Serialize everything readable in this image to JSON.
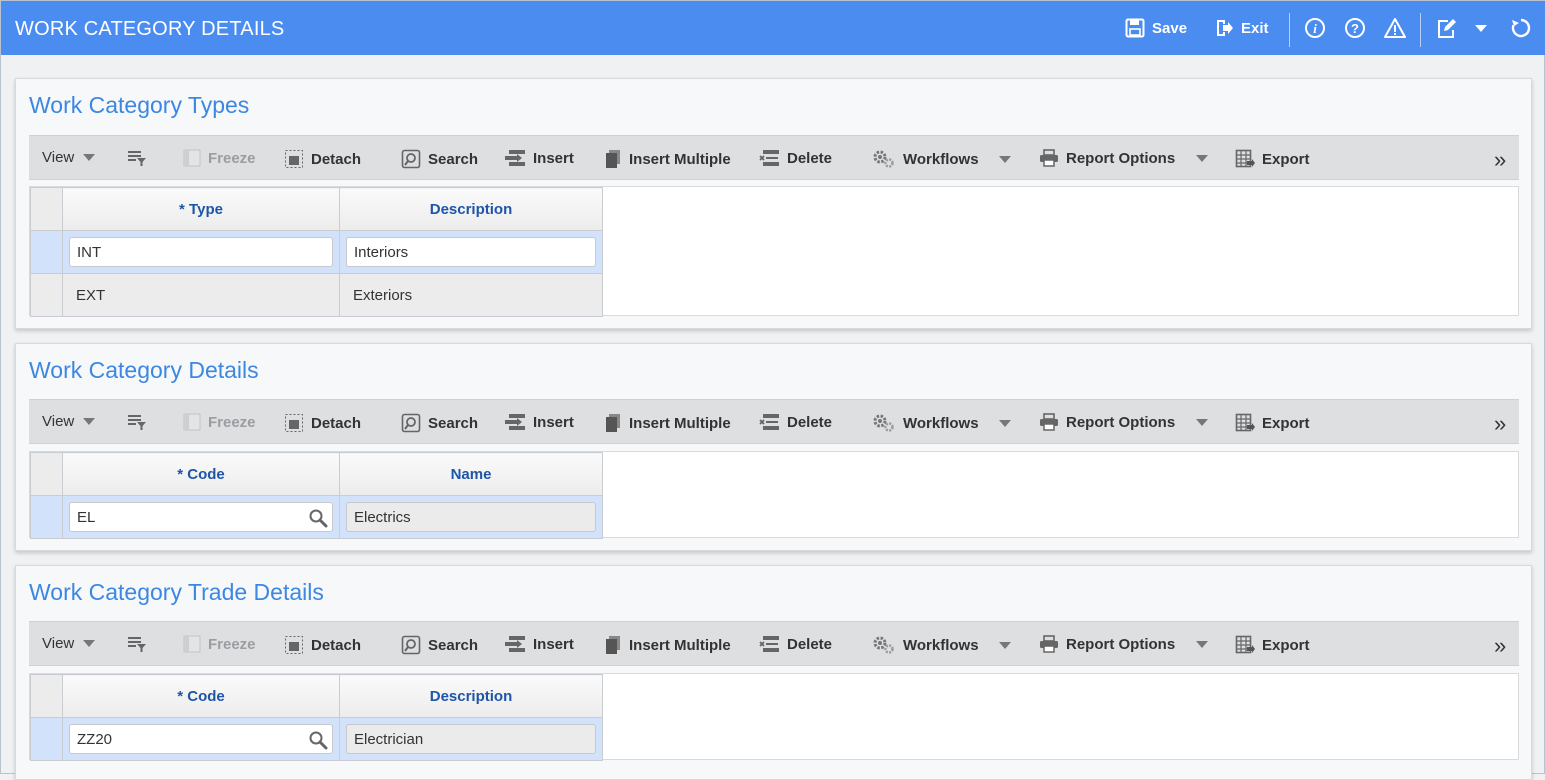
{
  "header": {
    "title": "WORK CATEGORY DETAILS",
    "save_label": "Save",
    "exit_label": "Exit",
    "accent": "#4a8cf0"
  },
  "toolbar": {
    "view": "View",
    "freeze": "Freeze",
    "detach": "Detach",
    "search": "Search",
    "insert": "Insert",
    "insert_multiple": "Insert Multiple",
    "delete": "Delete",
    "workflows": "Workflows",
    "report_options": "Report Options",
    "export": "Export"
  },
  "types": {
    "title": "Work Category Types",
    "columns": [
      "* Type",
      "Description"
    ],
    "rows": [
      {
        "type": "INT",
        "description": "Interiors"
      },
      {
        "type": "EXT",
        "description": "Exteriors"
      }
    ]
  },
  "details": {
    "title": "Work Category Details",
    "columns": [
      "* Code",
      "Name"
    ],
    "rows": [
      {
        "code": "EL",
        "name": "Electrics"
      }
    ]
  },
  "trades": {
    "title": "Work Category Trade Details",
    "columns": [
      "* Code",
      "Description"
    ],
    "rows": [
      {
        "code": "ZZ20",
        "description": "Electrician"
      }
    ]
  }
}
